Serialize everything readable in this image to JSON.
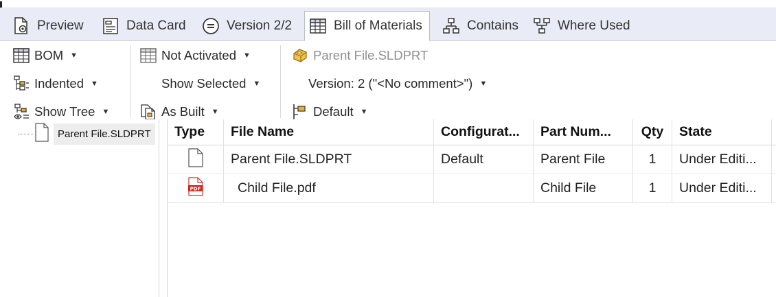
{
  "tabs": [
    {
      "label": "Preview",
      "icon": "preview-icon",
      "active": false
    },
    {
      "label": "Data Card",
      "icon": "data-card-icon",
      "active": false
    },
    {
      "label": "Version 2/2",
      "icon": "version-icon",
      "active": false
    },
    {
      "label": "Bill of Materials",
      "icon": "bom-table-icon",
      "active": true
    },
    {
      "label": "Contains",
      "icon": "contains-icon",
      "active": false
    },
    {
      "label": "Where Used",
      "icon": "where-used-icon",
      "active": false
    }
  ],
  "ribbon": {
    "bom": "BOM",
    "indented": "Indented",
    "show_tree": "Show Tree",
    "not_activated": "Not Activated",
    "show_selected": "Show Selected",
    "as_built": "As Built",
    "parent_file": "Parent File.SLDPRT",
    "version": "Version: 2 (\"<No comment>\")",
    "default": "Default"
  },
  "tree": {
    "root_label": "Parent File.SLDPRT"
  },
  "grid": {
    "columns": [
      "Type",
      "File Name",
      "Configurat...",
      "Part Num...",
      "Qty",
      "State"
    ],
    "rows": [
      {
        "type_icon": "document-icon",
        "file_name": "Parent File.SLDPRT",
        "configuration": "Default",
        "part_number": "Parent File",
        "qty": "1",
        "state": "Under Editi..."
      },
      {
        "type_icon": "pdf-icon",
        "file_name": "Child File.pdf",
        "configuration": "",
        "part_number": "Child File",
        "qty": "1",
        "state": "Under Editi..."
      }
    ]
  },
  "colors": {
    "tab_bar_bg": "#e9ebf6",
    "pdf_red": "#d9251c",
    "part_yellow": "#e8b23a"
  }
}
